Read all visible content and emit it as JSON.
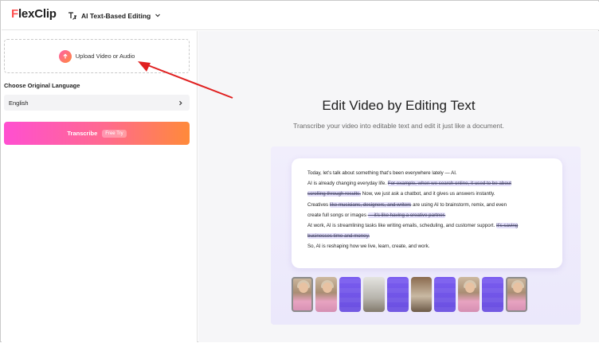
{
  "header": {
    "logo_prefix": "F",
    "logo_rest": "lexClip",
    "mode_label": "AI Text-Based Editing",
    "mode_icon": "text-edit-icon",
    "dropdown_icon": "chevron-down-icon"
  },
  "sidebar": {
    "upload_label": "Upload Video or Audio",
    "upload_icon": "upload-icon",
    "language_title": "Choose Original Language",
    "language_value": "English",
    "language_chevron": "chevron-right-icon",
    "transcribe_label": "Transcribe",
    "free_badge": "Free Try"
  },
  "hero": {
    "title": "Edit Video by Editing Text",
    "subtitle": "Transcribe your video into editable text and edit it just like a document."
  },
  "transcript": {
    "line1": "Today, let's talk about something that's been everywhere lately — AI.",
    "line2a": "AI is already changing everyday life.",
    "line2b": "For example, when we search online, it used to be about",
    "line3a": "scrolling through results.",
    "line3b": "Now, we just ask a chatbot, and it gives us answers instantly.",
    "line4a": "Creatives",
    "line4b": "like musicians, designers, and writers",
    "line4c": "are using AI to brainstorm, remix, and even",
    "line5a": "create full songs or images",
    "line5b": "— it's like having a creative partner.",
    "line6a": "At work, AI is streamlining tasks like writing emails, scheduling, and customer support.",
    "line6b": "It's saving",
    "line7a": "businesses time and money.",
    "line8": "So, AI is reshaping how we live, learn, create, and work."
  },
  "colors": {
    "brand_red": "#ff4f4f",
    "gradient_start": "#ff4fd1",
    "gradient_end": "#ff8a3a",
    "annotation_arrow": "#e02020",
    "highlight": "#e5e1fb"
  }
}
